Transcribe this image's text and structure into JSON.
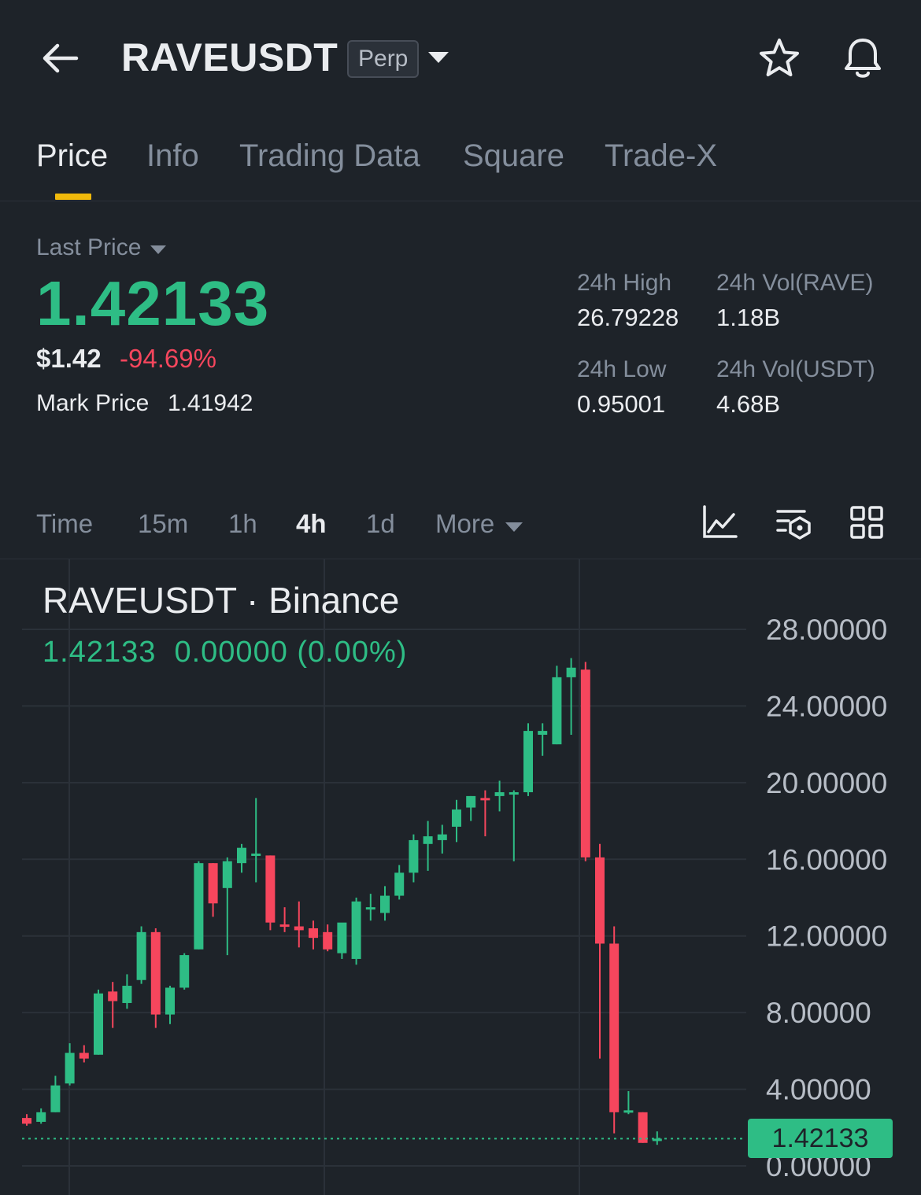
{
  "header": {
    "symbol": "RAVEUSDT",
    "contract_type": "Perp"
  },
  "tabs": [
    {
      "label": "Price",
      "active": true
    },
    {
      "label": "Info",
      "active": false
    },
    {
      "label": "Trading Data",
      "active": false
    },
    {
      "label": "Square",
      "active": false
    },
    {
      "label": "Trade-X",
      "active": false
    }
  ],
  "price": {
    "last_price_label": "Last Price",
    "last_price": "1.42133",
    "usd_price": "$1.42",
    "change_pct": "-94.69%",
    "mark_label": "Mark Price",
    "mark_value": "1.41942"
  },
  "stats": {
    "high_label": "24h High",
    "high_value": "26.79228",
    "low_label": "24h Low",
    "low_value": "0.95001",
    "vol_base_label": "24h Vol(RAVE)",
    "vol_base_value": "1.18B",
    "vol_quote_label": "24h Vol(USDT)",
    "vol_quote_value": "4.68B"
  },
  "intervals": [
    {
      "label": "Time",
      "active": false
    },
    {
      "label": "15m",
      "active": false
    },
    {
      "label": "1h",
      "active": false
    },
    {
      "label": "4h",
      "active": true
    },
    {
      "label": "1d",
      "active": false
    },
    {
      "label": "More",
      "active": false
    }
  ],
  "chart_legend": {
    "title": "RAVEUSDT · Binance",
    "ohlc": "1.42133  0.00000 (0.00%)"
  },
  "colors": {
    "up": "#2ebd85",
    "down": "#f6465d",
    "accent": "#f0b90b",
    "background": "#1e2329"
  },
  "icons": [
    "arrow-left-icon",
    "caret-down-icon",
    "star-icon",
    "bell-icon",
    "indicator-chart-icon",
    "chart-settings-icon",
    "grid-layout-icon"
  ],
  "chart_data": {
    "type": "candlestick",
    "ylim": [
      0,
      28.8
    ],
    "yticks": [
      "28.00000",
      "24.00000",
      "20.00000",
      "16.00000",
      "12.00000",
      "8.00000",
      "4.00000",
      "0.00000"
    ],
    "ytick_values": [
      28,
      24,
      20,
      16,
      12,
      8,
      4,
      0
    ],
    "current_price": 1.42133,
    "current_price_label": "1.42133",
    "candles": [
      {
        "o": 2.5,
        "h": 2.7,
        "l": 2.1,
        "c": 2.2
      },
      {
        "o": 2.3,
        "h": 3.0,
        "l": 2.2,
        "c": 2.8
      },
      {
        "o": 2.8,
        "h": 4.7,
        "l": 2.8,
        "c": 4.2
      },
      {
        "o": 4.3,
        "h": 6.4,
        "l": 4.2,
        "c": 5.9
      },
      {
        "o": 5.9,
        "h": 6.3,
        "l": 5.4,
        "c": 5.6
      },
      {
        "o": 5.8,
        "h": 9.2,
        "l": 5.8,
        "c": 9.0
      },
      {
        "o": 9.1,
        "h": 9.6,
        "l": 7.2,
        "c": 8.6
      },
      {
        "o": 8.5,
        "h": 10.0,
        "l": 8.2,
        "c": 9.4
      },
      {
        "o": 9.7,
        "h": 12.5,
        "l": 9.5,
        "c": 12.2
      },
      {
        "o": 12.2,
        "h": 12.4,
        "l": 7.2,
        "c": 7.9
      },
      {
        "o": 7.9,
        "h": 9.4,
        "l": 7.4,
        "c": 9.3
      },
      {
        "o": 9.3,
        "h": 11.1,
        "l": 9.2,
        "c": 11.0
      },
      {
        "o": 11.3,
        "h": 15.9,
        "l": 11.3,
        "c": 15.8
      },
      {
        "o": 15.8,
        "h": 15.8,
        "l": 13.0,
        "c": 13.7
      },
      {
        "o": 14.5,
        "h": 16.1,
        "l": 11.0,
        "c": 15.9
      },
      {
        "o": 15.8,
        "h": 16.8,
        "l": 15.3,
        "c": 16.6
      },
      {
        "o": 16.3,
        "h": 19.2,
        "l": 14.8,
        "c": 16.3
      },
      {
        "o": 16.2,
        "h": 16.2,
        "l": 12.3,
        "c": 12.7
      },
      {
        "o": 12.6,
        "h": 13.5,
        "l": 12.2,
        "c": 12.5
      },
      {
        "o": 12.5,
        "h": 13.8,
        "l": 11.4,
        "c": 12.3
      },
      {
        "o": 12.4,
        "h": 12.8,
        "l": 11.3,
        "c": 11.9
      },
      {
        "o": 12.2,
        "h": 12.6,
        "l": 11.2,
        "c": 11.3
      },
      {
        "o": 11.1,
        "h": 12.6,
        "l": 10.8,
        "c": 12.7
      },
      {
        "o": 10.8,
        "h": 14.0,
        "l": 10.5,
        "c": 13.8
      },
      {
        "o": 13.5,
        "h": 14.2,
        "l": 12.8,
        "c": 13.5
      },
      {
        "o": 13.2,
        "h": 14.6,
        "l": 12.8,
        "c": 14.1
      },
      {
        "o": 14.1,
        "h": 15.7,
        "l": 13.9,
        "c": 15.3
      },
      {
        "o": 15.3,
        "h": 17.3,
        "l": 14.8,
        "c": 17.0
      },
      {
        "o": 16.8,
        "h": 18.0,
        "l": 15.4,
        "c": 17.2
      },
      {
        "o": 17.0,
        "h": 17.8,
        "l": 16.3,
        "c": 17.3
      },
      {
        "o": 17.7,
        "h": 19.1,
        "l": 16.9,
        "c": 18.6
      },
      {
        "o": 18.7,
        "h": 19.3,
        "l": 18.0,
        "c": 19.3
      },
      {
        "o": 19.2,
        "h": 19.6,
        "l": 17.2,
        "c": 19.1
      },
      {
        "o": 19.3,
        "h": 20.1,
        "l": 18.5,
        "c": 19.5
      },
      {
        "o": 19.4,
        "h": 19.6,
        "l": 15.9,
        "c": 19.5
      },
      {
        "o": 19.5,
        "h": 23.1,
        "l": 19.3,
        "c": 22.7
      },
      {
        "o": 22.5,
        "h": 23.1,
        "l": 21.4,
        "c": 22.7
      },
      {
        "o": 22.0,
        "h": 26.1,
        "l": 22.0,
        "c": 25.5
      },
      {
        "o": 25.5,
        "h": 26.5,
        "l": 22.5,
        "c": 26.0
      },
      {
        "o": 25.9,
        "h": 26.3,
        "l": 15.9,
        "c": 16.1
      },
      {
        "o": 16.1,
        "h": 16.8,
        "l": 5.6,
        "c": 11.6
      },
      {
        "o": 11.6,
        "h": 12.5,
        "l": 1.7,
        "c": 2.8
      },
      {
        "o": 2.9,
        "h": 3.9,
        "l": 2.7,
        "c": 2.9
      },
      {
        "o": 2.8,
        "h": 2.8,
        "l": 1.2,
        "c": 1.2
      },
      {
        "o": 1.3,
        "h": 1.8,
        "l": 1.1,
        "c": 1.42
      }
    ]
  }
}
